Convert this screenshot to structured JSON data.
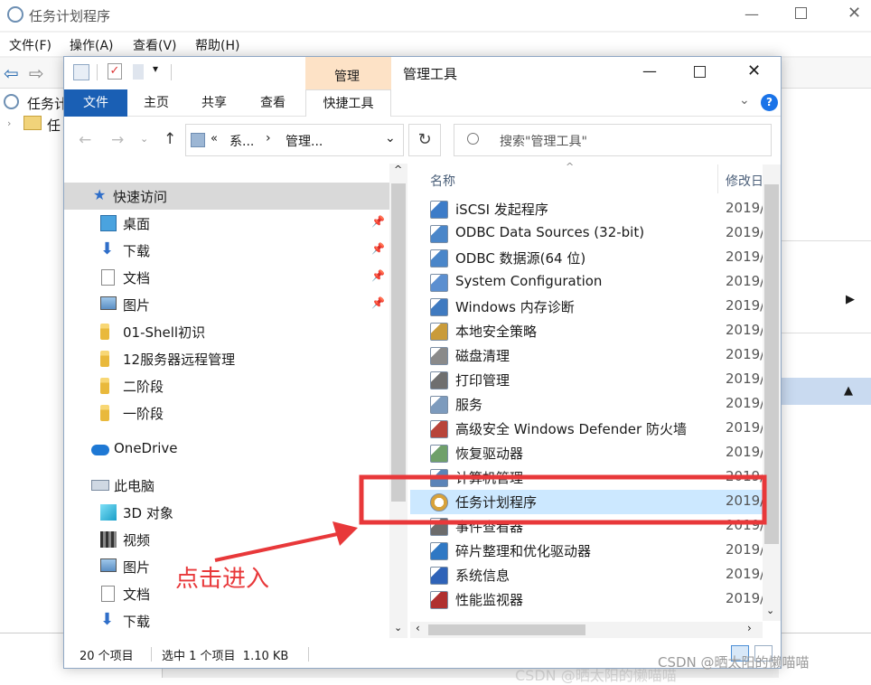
{
  "bg_window": {
    "title": "任务计划程序",
    "menu": [
      "文件(F)",
      "操作(A)",
      "查看(V)",
      "帮助(H)"
    ],
    "tree_item_1": "任务计",
    "tree_item_2": "任"
  },
  "explorer": {
    "context_tab": "管理",
    "window_title": "管理工具",
    "tabs": [
      "文件",
      "主页",
      "共享",
      "查看",
      "快捷工具"
    ],
    "address": {
      "crumb1": "系...",
      "crumb2": "管理...",
      "sep": "«",
      "arrow": "›"
    },
    "search_placeholder": "搜索\"管理工具\"",
    "nav": {
      "quick_access": "快速访问",
      "items": [
        {
          "label": "桌面",
          "icon": "desktop-icon",
          "pinned": true
        },
        {
          "label": "下载",
          "icon": "download-icon",
          "pinned": true
        },
        {
          "label": "文档",
          "icon": "document-icon",
          "pinned": true
        },
        {
          "label": "图片",
          "icon": "picture-icon",
          "pinned": true
        },
        {
          "label": "01-Shell初识",
          "icon": "folder-icon",
          "pinned": false
        },
        {
          "label": "12服务器远程管理",
          "icon": "folder-icon",
          "pinned": false
        },
        {
          "label": "二阶段",
          "icon": "folder-icon",
          "pinned": false
        },
        {
          "label": "一阶段",
          "icon": "folder-icon",
          "pinned": false
        }
      ],
      "onedrive": "OneDrive",
      "this_pc": "此电脑",
      "pc_items": [
        {
          "label": "3D 对象",
          "icon": "cube-icon"
        },
        {
          "label": "视频",
          "icon": "video-icon"
        },
        {
          "label": "图片",
          "icon": "picture-icon"
        },
        {
          "label": "文档",
          "icon": "document-icon"
        },
        {
          "label": "下载",
          "icon": "download-icon"
        }
      ]
    },
    "columns": {
      "name": "名称",
      "modified": "修改日"
    },
    "files": [
      {
        "name": "iSCSI 发起程序",
        "date": "2019/"
      },
      {
        "name": "ODBC Data Sources (32-bit)",
        "date": "2019/"
      },
      {
        "name": "ODBC 数据源(64 位)",
        "date": "2019/"
      },
      {
        "name": "System Configuration",
        "date": "2019/"
      },
      {
        "name": "Windows 内存诊断",
        "date": "2019/"
      },
      {
        "name": "本地安全策略",
        "date": "2019/"
      },
      {
        "name": "磁盘清理",
        "date": "2019/"
      },
      {
        "name": "打印管理",
        "date": "2019/"
      },
      {
        "name": "服务",
        "date": "2019/"
      },
      {
        "name": "高级安全 Windows Defender 防火墙",
        "date": "2019/"
      },
      {
        "name": "恢复驱动器",
        "date": "2019/"
      },
      {
        "name": "计算机管理",
        "date": "2019/"
      },
      {
        "name": "任务计划程序",
        "date": "2019/"
      },
      {
        "name": "事件查看器",
        "date": "2019/"
      },
      {
        "name": "碎片整理和优化驱动器",
        "date": "2019/"
      },
      {
        "name": "系统信息",
        "date": "2019/"
      },
      {
        "name": "性能监视器",
        "date": "2019/"
      }
    ],
    "status": {
      "count": "20 个项目",
      "selected": "选中 1 个项目  1.10 KB"
    }
  },
  "annotation": {
    "text": "点击进入",
    "color": "#e8383a"
  },
  "watermark": {
    "main": "CSDN @晒太阳的懒喵喵",
    "ghost": "CSDN @晒太阳的懒喵喵"
  },
  "colors": {
    "accent": "#1a5fb4",
    "selection": "#cce8ff",
    "context_tab": "#fde2c6"
  }
}
